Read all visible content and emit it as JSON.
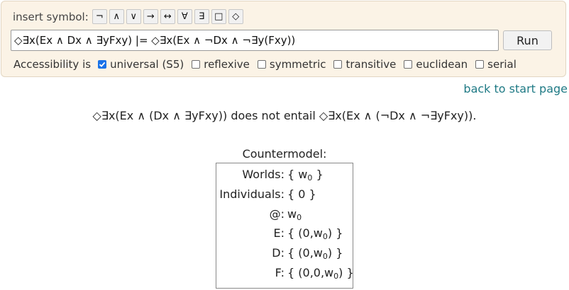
{
  "toolbar": {
    "insert_label": "insert symbol:",
    "symbols": [
      "¬",
      "∧",
      "∨",
      "→",
      "↔",
      "∀",
      "∃",
      "□",
      "◇"
    ]
  },
  "formula": {
    "value": "◇∃x(Ex ∧ Dx ∧ ∃yFxy) |= ◇∃x(Ex ∧ ¬Dx ∧ ¬∃y(Fxy))",
    "run_label": "Run"
  },
  "accessibility": {
    "label": "Accessibility is",
    "options": [
      {
        "label": "universal (S5)",
        "checked": true
      },
      {
        "label": "reflexive",
        "checked": false
      },
      {
        "label": "symmetric",
        "checked": false
      },
      {
        "label": "transitive",
        "checked": false
      },
      {
        "label": "euclidean",
        "checked": false
      },
      {
        "label": "serial",
        "checked": false
      }
    ]
  },
  "back_link": "back to start page",
  "result": "◇∃x(Ex ∧ (Dx ∧ ∃yFxy)) does not entail ◇∃x(Ex ∧ (¬Dx ∧ ¬∃yFxy)).",
  "countermodel": {
    "title": "Countermodel:",
    "rows": [
      {
        "key": "Worlds:",
        "pre": "{ w",
        "sub": "0",
        "post": " }"
      },
      {
        "key": "Individuals:",
        "pre": "{ 0 }",
        "sub": "",
        "post": ""
      },
      {
        "key": "@:",
        "pre": "w",
        "sub": "0",
        "post": ""
      },
      {
        "key": "E:",
        "pre": "{ (0,w",
        "sub": "0",
        "post": ") }"
      },
      {
        "key": "D:",
        "pre": "{ (0,w",
        "sub": "0",
        "post": ") }"
      },
      {
        "key": "F:",
        "pre": "{ (0,0,w",
        "sub": "0",
        "post": ") }"
      }
    ]
  },
  "colors": {
    "panel_bg": "#fbf3e6",
    "link": "#1f7a85",
    "checkbox_checked": "#1a73e8"
  }
}
